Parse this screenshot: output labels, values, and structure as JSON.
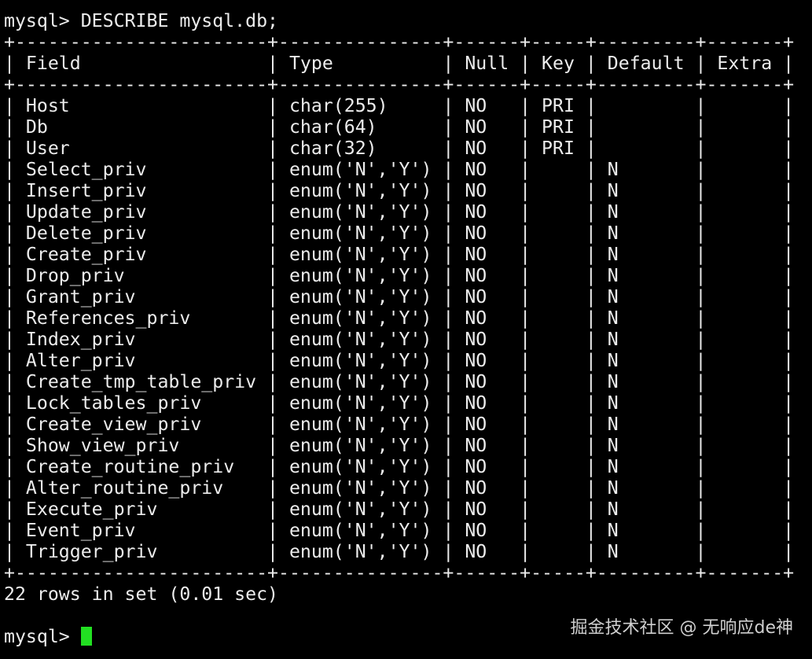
{
  "terminal": {
    "top_partial_line": "",
    "command_line": "mysql> DESCRIBE mysql.db;",
    "border_line": "+-----------------------+---------------+------+-----+---------+-------+",
    "header_line": "| Field                 | Type          | Null | Key | Default | Extra |",
    "rows": [
      "| Host                  | char(255)     | NO   | PRI |         |       |",
      "| Db                    | char(64)      | NO   | PRI |         |       |",
      "| User                  | char(32)      | NO   | PRI |         |       |",
      "| Select_priv           | enum('N','Y') | NO   |     | N       |       |",
      "| Insert_priv           | enum('N','Y') | NO   |     | N       |       |",
      "| Update_priv           | enum('N','Y') | NO   |     | N       |       |",
      "| Delete_priv           | enum('N','Y') | NO   |     | N       |       |",
      "| Create_priv           | enum('N','Y') | NO   |     | N       |       |",
      "| Drop_priv             | enum('N','Y') | NO   |     | N       |       |",
      "| Grant_priv            | enum('N','Y') | NO   |     | N       |       |",
      "| References_priv       | enum('N','Y') | NO   |     | N       |       |",
      "| Index_priv            | enum('N','Y') | NO   |     | N       |       |",
      "| Alter_priv            | enum('N','Y') | NO   |     | N       |       |",
      "| Create_tmp_table_priv | enum('N','Y') | NO   |     | N       |       |",
      "| Lock_tables_priv      | enum('N','Y') | NO   |     | N       |       |",
      "| Create_view_priv      | enum('N','Y') | NO   |     | N       |       |",
      "| Show_view_priv        | enum('N','Y') | NO   |     | N       |       |",
      "| Create_routine_priv   | enum('N','Y') | NO   |     | N       |       |",
      "| Alter_routine_priv    | enum('N','Y') | NO   |     | N       |       |",
      "| Execute_priv          | enum('N','Y') | NO   |     | N       |       |",
      "| Event_priv            | enum('N','Y') | NO   |     | N       |       |",
      "| Trigger_priv          | enum('N','Y') | NO   |     | N       |       |"
    ],
    "result_summary": "22 rows in set (0.01 sec)",
    "prompt": "mysql> "
  },
  "watermark": "掘金技术社区 @ 无响应de神",
  "colors": {
    "background": "#000000",
    "text": "#ececec",
    "cursor": "#22e022",
    "watermark": "#cfcfcf"
  }
}
